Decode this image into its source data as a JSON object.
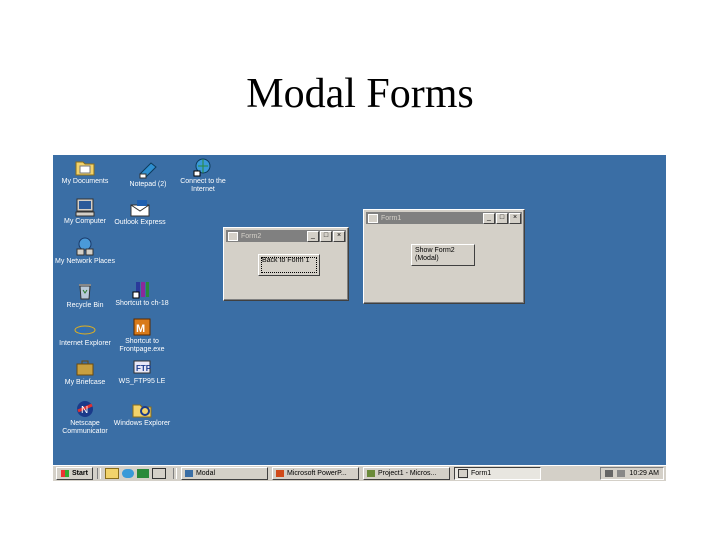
{
  "slide": {
    "title": "Modal Forms"
  },
  "desktop_icons": [
    {
      "label": "My Documents",
      "icon": "folder-documents-icon"
    },
    {
      "label": "Notepad (2)",
      "icon": "notepad-icon"
    },
    {
      "label": "Connect to the Internet",
      "icon": "connect-internet-icon"
    },
    {
      "label": "My Computer",
      "icon": "computer-icon"
    },
    {
      "label": "Outlook Express",
      "icon": "outlook-express-icon"
    },
    {
      "label": "My Network Places",
      "icon": "network-places-icon"
    },
    {
      "label": "Recycle Bin",
      "icon": "recycle-bin-icon"
    },
    {
      "label": "Shortcut to ch-18",
      "icon": "shortcut-icon"
    },
    {
      "label": "Internet Explorer",
      "icon": "internet-explorer-icon"
    },
    {
      "label": "Shortcut to Frontpage.exe",
      "icon": "frontpage-icon"
    },
    {
      "label": "My Briefcase",
      "icon": "briefcase-icon"
    },
    {
      "label": "WS_FTP95 LE",
      "icon": "ws-ftp-icon"
    },
    {
      "label": "Netscape Communicator",
      "icon": "netscape-icon"
    },
    {
      "label": "Windows Explorer",
      "icon": "windows-explorer-icon"
    }
  ],
  "form2": {
    "title": "Form2",
    "button": "Back to Form 1"
  },
  "form1": {
    "title": "Form1",
    "button": "Show Form2 (Modal)"
  },
  "window_controls": {
    "minimize": "_",
    "maximize": "□",
    "close": "×"
  },
  "taskbar": {
    "start_label": "Start",
    "tasks": [
      {
        "label": "Modal"
      },
      {
        "label": "Microsoft PowerP..."
      },
      {
        "label": "Project1 - Micros..."
      },
      {
        "label": "Form1"
      }
    ],
    "clock": "10:29 AM"
  }
}
